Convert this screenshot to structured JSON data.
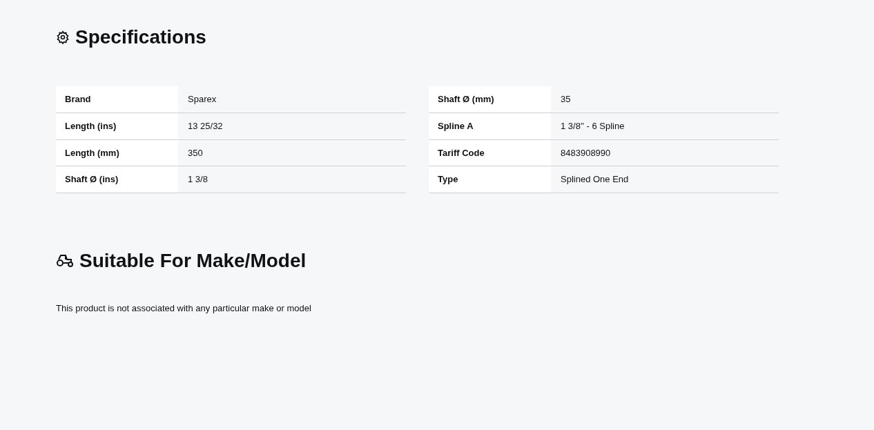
{
  "specifications": {
    "title": "Specifications",
    "tables": [
      [
        {
          "label": "Brand",
          "value": "Sparex"
        },
        {
          "label": "Length (ins)",
          "value": "13 25/32"
        },
        {
          "label": "Length (mm)",
          "value": "350"
        },
        {
          "label": "Shaft Ø (ins)",
          "value": "1 3/8"
        }
      ],
      [
        {
          "label": "Shaft Ø (mm)",
          "value": "35"
        },
        {
          "label": "Spline A",
          "value": "1 3/8'' - 6 Spline"
        },
        {
          "label": "Tariff Code",
          "value": "8483908990"
        },
        {
          "label": "Type",
          "value": "Splined One End"
        }
      ]
    ]
  },
  "suitable": {
    "title": "Suitable For Make/Model",
    "message": "This product is not associated with any particular make or model"
  }
}
